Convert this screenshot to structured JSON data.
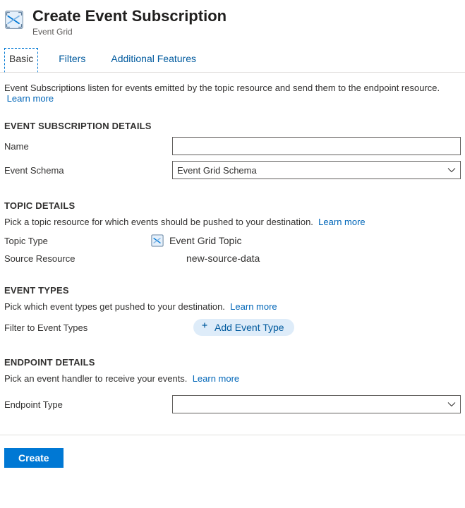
{
  "header": {
    "title": "Create Event Subscription",
    "subtitle": "Event Grid"
  },
  "tabs": [
    {
      "label": "Basic",
      "active": true
    },
    {
      "label": "Filters",
      "active": false
    },
    {
      "label": "Additional Features",
      "active": false
    }
  ],
  "intro_text": "Event Subscriptions listen for events emitted by the topic resource and send them to the endpoint resource.",
  "intro_link": "Learn more",
  "subscription_details": {
    "heading": "EVENT SUBSCRIPTION DETAILS",
    "name_label": "Name",
    "name_value": "",
    "schema_label": "Event Schema",
    "schema_value": "Event Grid Schema"
  },
  "topic_details": {
    "heading": "TOPIC DETAILS",
    "description": "Pick a topic resource for which events should be pushed to your destination.",
    "learn_more": "Learn more",
    "type_label": "Topic Type",
    "type_value": "Event Grid Topic",
    "source_label": "Source Resource",
    "source_value": "new-source-data"
  },
  "event_types": {
    "heading": "EVENT TYPES",
    "description": "Pick which event types get pushed to your destination.",
    "learn_more": "Learn more",
    "filter_label": "Filter to Event Types",
    "add_button": "Add Event Type"
  },
  "endpoint_details": {
    "heading": "ENDPOINT DETAILS",
    "description": "Pick an event handler to receive your events.",
    "learn_more": "Learn more",
    "type_label": "Endpoint Type",
    "type_value": ""
  },
  "footer": {
    "create_button": "Create"
  }
}
